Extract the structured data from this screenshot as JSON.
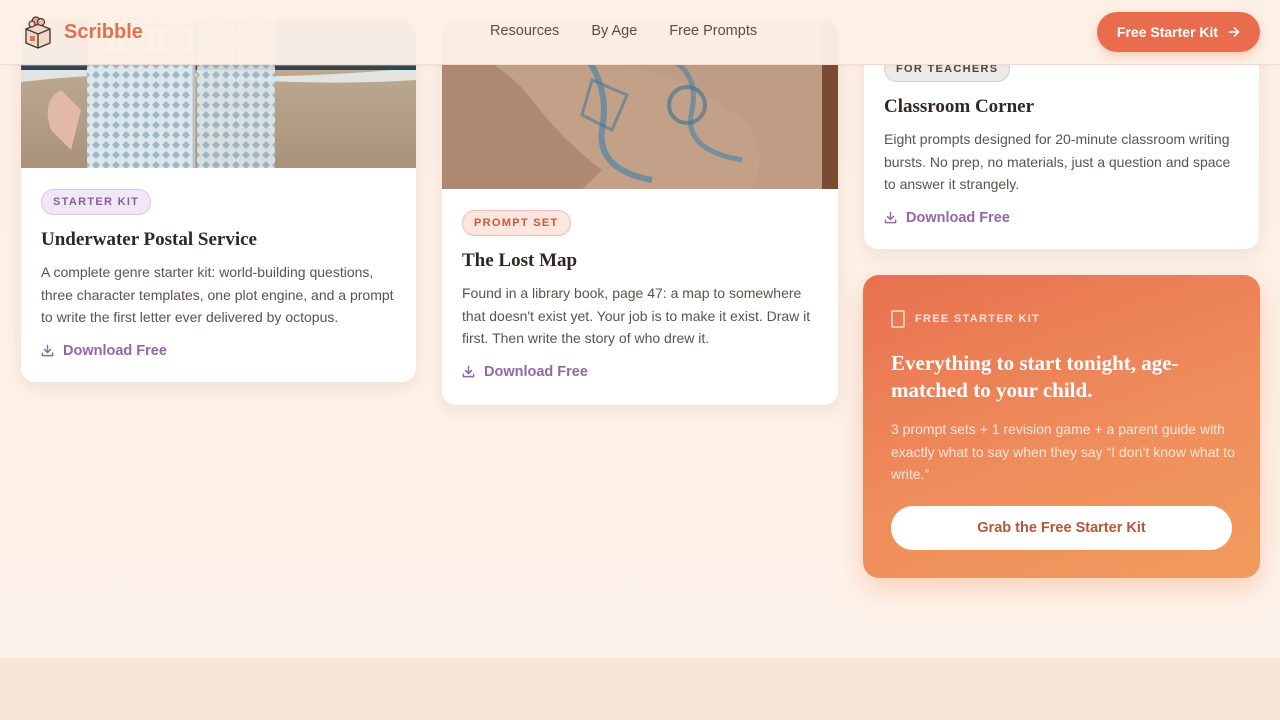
{
  "header": {
    "brand": "Scribble",
    "nav": [
      "Resources",
      "By Age",
      "Free Prompts"
    ],
    "cta": "Free Starter Kit"
  },
  "cards": [
    {
      "tag": "STARTER KIT",
      "title": "Underwater Postal Service",
      "description": "A complete genre starter kit: world-building questions, three character templates, one plot engine, and a prompt to write the first letter ever delivered by octopus.",
      "action": "Download Free"
    },
    {
      "tag": "PROMPT SET",
      "title": "The Lost Map",
      "description": "Found in a library book, page 47: a map to somewhere that doesn't exist yet. Your job is to make it exist. Draw it first. Then write the story of who drew it.",
      "action": "Download Free"
    },
    {
      "tag": "FOR TEACHERS",
      "title": "Classroom Corner",
      "description": "Eight prompts designed for 20-minute classroom writing bursts. No prep, no materials, just a question and space to answer it strangely.",
      "action": "Download Free"
    }
  ],
  "promo": {
    "eyebrow": "FREE STARTER KIT",
    "title": "Everything to start tonight, age-matched to your child.",
    "description": "3 prompt sets + 1 revision game + a parent guide with exactly what to say when they say “I don’t know what to write.”",
    "button": "Grab the Free Starter Kit"
  },
  "colors": {
    "accent": "#e86c4d",
    "link": "#9366a8",
    "background": "#fdf0e6"
  }
}
